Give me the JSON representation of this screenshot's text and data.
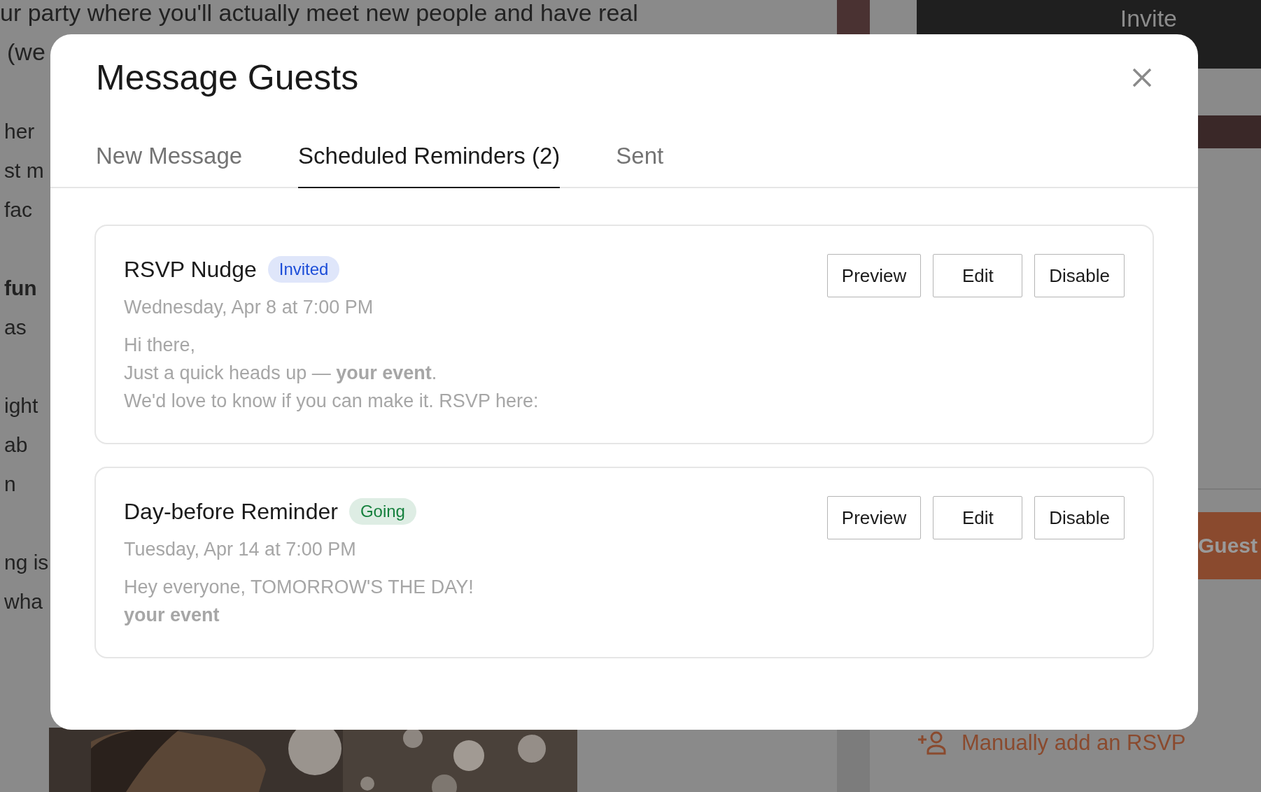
{
  "background": {
    "top_lines": [
      "ur party where you'll actually meet new people and have real",
      "(we"
    ],
    "left_paragraphs": [
      [
        {
          "text": "her",
          "bold": false
        },
        {
          "text": "st m",
          "bold": false
        },
        {
          "text": "fac",
          "bold": false
        }
      ],
      [
        {
          "text": "fun",
          "bold": true
        },
        {
          "text": "as",
          "bold": false
        }
      ],
      [
        {
          "text": "ight",
          "bold": false
        },
        {
          "text": "ab",
          "bold": false
        },
        {
          "text": "n",
          "bold": false
        }
      ],
      [
        {
          "text": "ng is",
          "bold": false
        },
        {
          "text": "wha",
          "bold": false
        }
      ]
    ],
    "invite_button": "Invite",
    "guests_button": "Guest",
    "add_rsvp_link": "Manually add an RSVP"
  },
  "modal": {
    "title": "Message Guests",
    "tabs": [
      {
        "label": "New Message",
        "selected": false
      },
      {
        "label": "Scheduled Reminders (2)",
        "selected": true
      },
      {
        "label": "Sent",
        "selected": false
      }
    ],
    "reminders": [
      {
        "title": "RSVP Nudge",
        "badge": {
          "label": "Invited",
          "color": "#1d4ed8"
        },
        "schedule": "Wednesday, Apr 8 at 7:00 PM",
        "message": [
          {
            "text": "Hi there,",
            "bold": false
          },
          {
            "text": "Just a quick heads up — **your event**.",
            "bold": false
          },
          {
            "text": "We'd love to know if you can make it. RSVP here:",
            "bold": false
          }
        ],
        "actions": [
          "Preview",
          "Edit",
          "Disable"
        ]
      },
      {
        "title": "Day-before Reminder",
        "badge": {
          "label": "Going",
          "color": "#15803d"
        },
        "schedule": "Tuesday, Apr 14 at 7:00 PM",
        "message": [
          {
            "text": "Hey everyone, TOMORROW'S THE DAY!",
            "bold": false
          },
          {
            "text": "your event",
            "bold": true
          }
        ],
        "actions": [
          "Preview",
          "Edit",
          "Disable"
        ]
      }
    ]
  }
}
